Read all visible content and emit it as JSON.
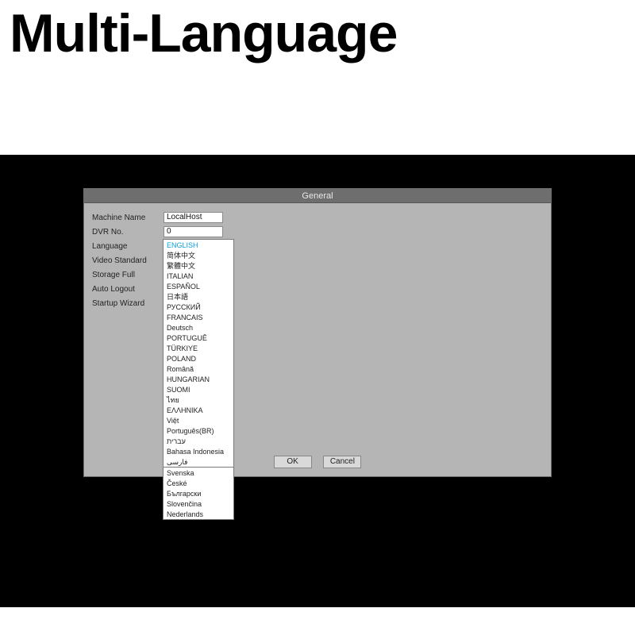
{
  "headline": "Multi-Language",
  "dialog": {
    "title": "General",
    "labels": {
      "machine_name": "Machine Name",
      "dvr_no": "DVR No.",
      "language": "Language",
      "video_standard": "Video Standard",
      "storage_full": "Storage Full",
      "auto_logout": "Auto Logout",
      "startup_wizard": "Startup Wizard"
    },
    "values": {
      "machine_name": "LocalHost",
      "dvr_no": "0",
      "language_selected": "ENGLISH"
    },
    "buttons": {
      "ok": "OK",
      "cancel": "Cancel"
    }
  },
  "dropdown": {
    "items_upper": [
      "ENGLISH",
      "简体中文",
      "繁體中文",
      "ITALIAN",
      "ESPAÑOL",
      "日本語",
      "РУССКИЙ",
      "FRANCAIS",
      "Deutsch",
      "PORTUGUÊ",
      "TÜRKIYE",
      "POLAND",
      "Română",
      "HUNGARIAN",
      "SUOMI",
      "ไทย",
      "ΕΛΛΗΝΙΚΑ",
      "Việt",
      "Português(BR)",
      "עברית",
      "Bahasa Indonesia",
      "فارسی"
    ],
    "items_lower": [
      "Svenska",
      "České",
      "Български",
      "Slovenčina",
      "Nederlands"
    ]
  }
}
